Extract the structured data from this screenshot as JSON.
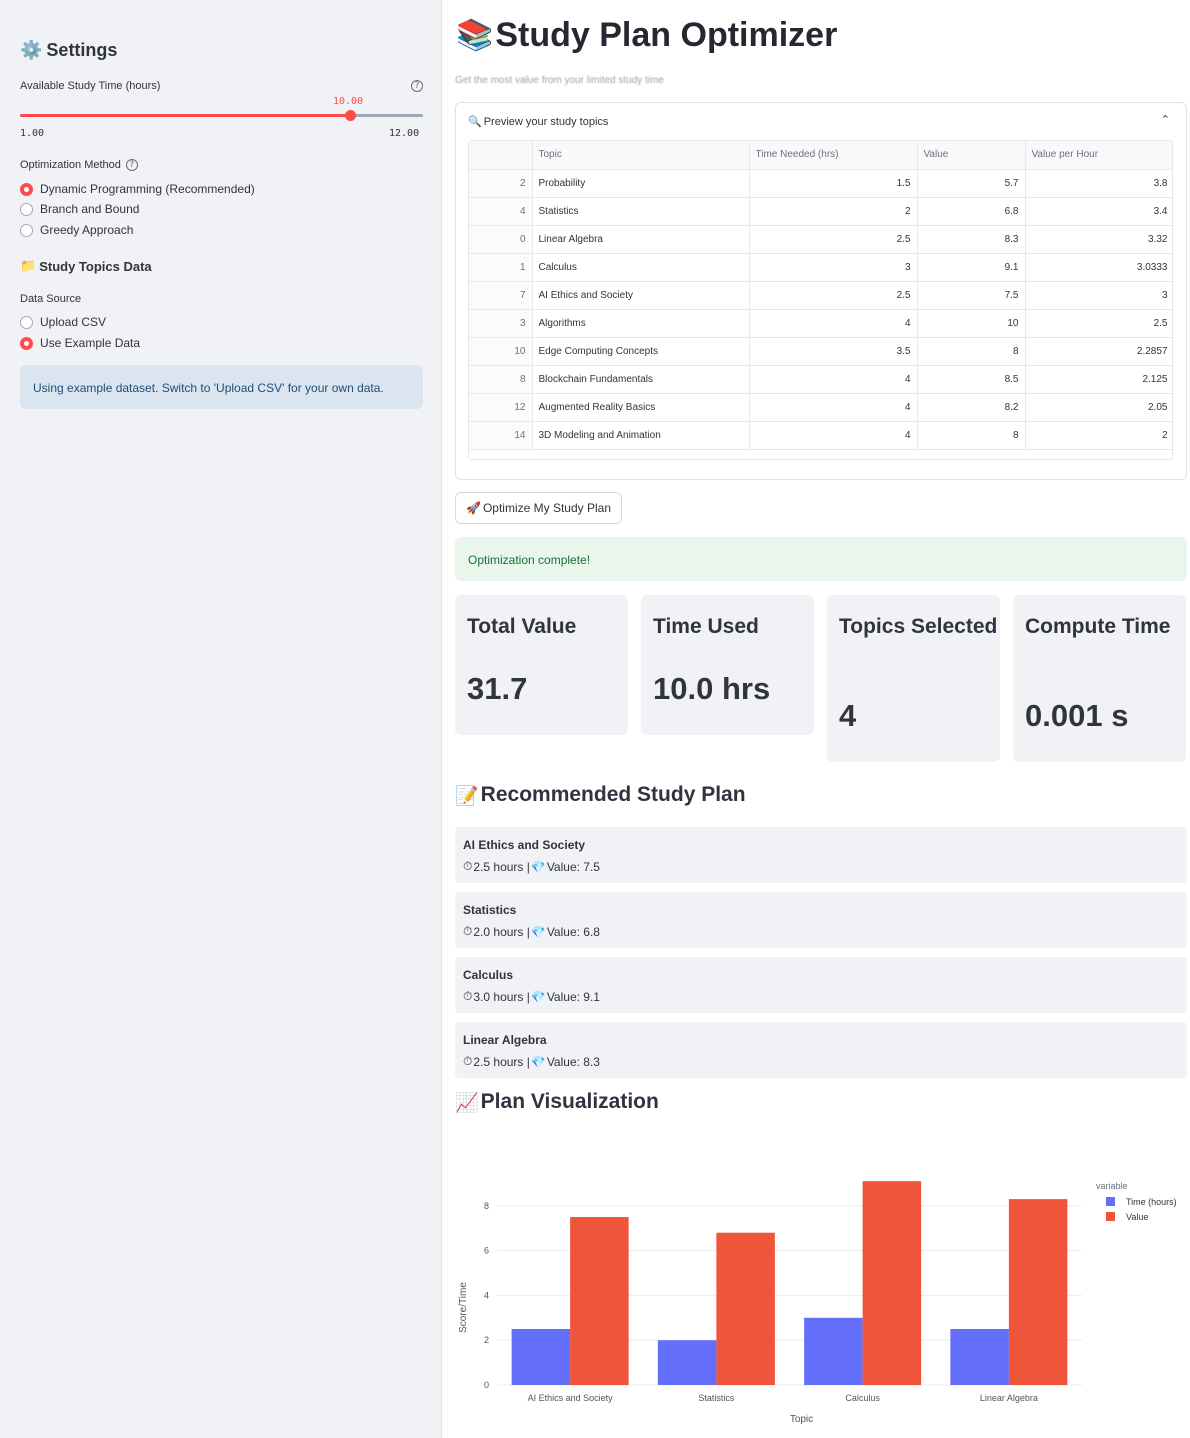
{
  "sidebar": {
    "title": "Settings",
    "title_icon": "gear-icon",
    "slider": {
      "label": "Available Study Time (hours)",
      "value": 10.0,
      "value_label": "10.00",
      "min": 1.0,
      "max": 12.0,
      "min_label": "1.00",
      "max_label": "12.00"
    },
    "method": {
      "label": "Optimization Method",
      "options": [
        "Dynamic Programming (Recommended)",
        "Branch and Bound",
        "Greedy Approach"
      ],
      "selected": 0
    },
    "topics_title": "Study Topics Data",
    "topics_icon": "folder-icon",
    "source": {
      "label": "Data Source",
      "options": [
        "Upload CSV",
        "Use Example Data"
      ],
      "selected": 1
    },
    "info": "Using example dataset. Switch to 'Upload CSV' for your own data."
  },
  "main": {
    "title": "Study Plan Optimizer",
    "title_icon": "books-icon",
    "caption": "Get the most value from your limited study time",
    "expander": {
      "label": "Preview your study topics",
      "icon": "magnifier-icon",
      "columns": [
        "",
        "Topic",
        "Time Needed (hrs)",
        "Value",
        "Value per Hour"
      ],
      "rows": [
        [
          "2",
          "Probability",
          "1.5",
          "5.7",
          "3.8"
        ],
        [
          "4",
          "Statistics",
          "2",
          "6.8",
          "3.4"
        ],
        [
          "0",
          "Linear Algebra",
          "2.5",
          "8.3",
          "3.32"
        ],
        [
          "1",
          "Calculus",
          "3",
          "9.1",
          "3.0333"
        ],
        [
          "7",
          "AI Ethics and Society",
          "2.5",
          "7.5",
          "3"
        ],
        [
          "3",
          "Algorithms",
          "4",
          "10",
          "2.5"
        ],
        [
          "10",
          "Edge Computing Concepts",
          "3.5",
          "8",
          "2.2857"
        ],
        [
          "8",
          "Blockchain Fundamentals",
          "4",
          "8.5",
          "2.125"
        ],
        [
          "12",
          "Augmented Reality Basics",
          "4",
          "8.2",
          "2.05"
        ],
        [
          "14",
          "3D Modeling and Animation",
          "4",
          "8",
          "2"
        ]
      ]
    },
    "optimize_button": "Optimize My Study Plan",
    "optimize_icon": "rocket-icon",
    "success": "Optimization complete!",
    "metrics": [
      {
        "label": "Total Value",
        "value": "31.7"
      },
      {
        "label": "Time Used",
        "value": "10.0 hrs"
      },
      {
        "label": "Topics Selected",
        "value": "4"
      },
      {
        "label": "Compute Time",
        "value": "0.001 s"
      }
    ],
    "plan_title": "Recommended Study Plan",
    "plan_icon": "memo-icon",
    "plan": [
      {
        "name": "AI Ethics and Society",
        "info": "2.5 hours | ",
        "value": "Value: 7.5"
      },
      {
        "name": "Statistics",
        "info": "2.0 hours | ",
        "value": "Value: 6.8"
      },
      {
        "name": "Calculus",
        "info": "3.0 hours | ",
        "value": "Value: 9.1"
      },
      {
        "name": "Linear Algebra",
        "info": "2.5 hours | ",
        "value": "Value: 8.3"
      }
    ],
    "viz_title": "Plan Visualization",
    "viz_icon": "chart-up-icon"
  },
  "chart_data": {
    "type": "bar",
    "categories": [
      "AI Ethics and Society",
      "Statistics",
      "Calculus",
      "Linear Algebra"
    ],
    "series": [
      {
        "name": "Time (hours)",
        "values": [
          2.5,
          2.0,
          3.0,
          2.5
        ],
        "color": "#636efa"
      },
      {
        "name": "Value",
        "values": [
          7.5,
          6.8,
          9.1,
          8.3
        ],
        "color": "#ef553b"
      }
    ],
    "xlabel": "Topic",
    "ylabel": "Score/Time",
    "yticks": [
      0,
      2,
      4,
      6,
      8
    ],
    "ylim": [
      0,
      9.6
    ],
    "legend_title": "variable",
    "legend_position": "top-right",
    "grid": true
  },
  "colors": {
    "accent": "#ff4b4b",
    "sidebar_bg": "#f0f2f6",
    "info_bg": "#dbe5f0",
    "success_bg": "#e8f6ec"
  }
}
